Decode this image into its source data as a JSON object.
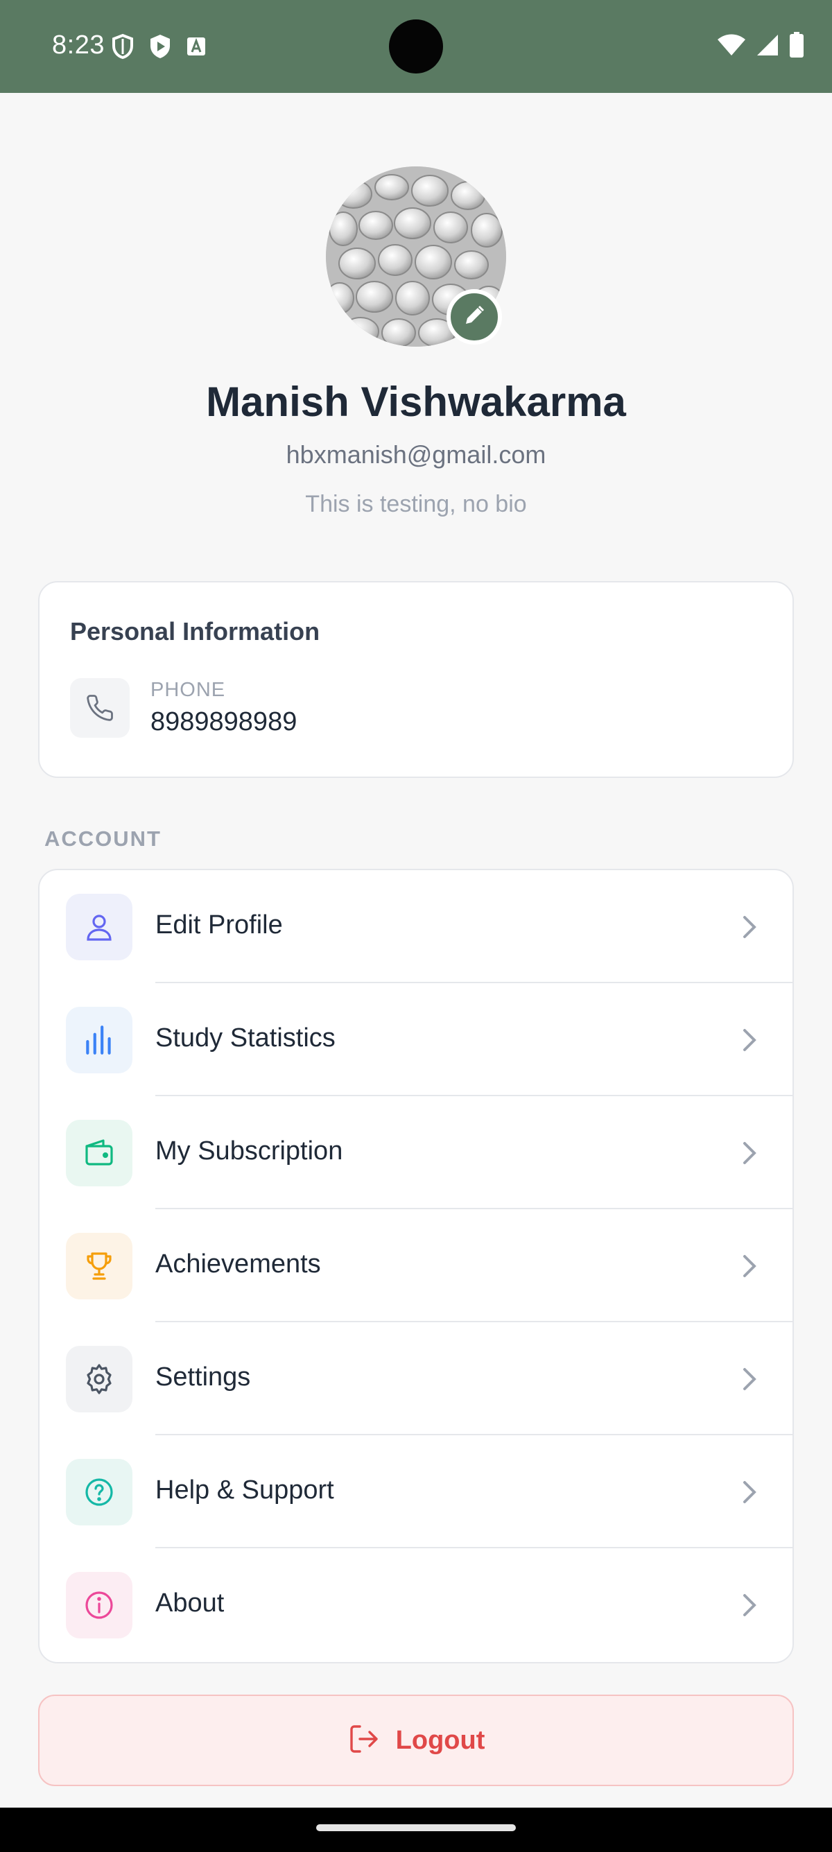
{
  "status_bar": {
    "time": "8:23",
    "icons_left": [
      "shield-outline-icon",
      "play-shield-icon",
      "font-a-icon"
    ],
    "icons_right": [
      "wifi-icon",
      "signal-icon",
      "battery-icon"
    ],
    "background": "#5a7a62"
  },
  "profile": {
    "name": "Manish Vishwakarma",
    "email": "hbxmanish@gmail.com",
    "bio": "This is testing, no bio",
    "edit_icon": "pencil-icon"
  },
  "personal_info": {
    "title": "Personal Information",
    "phone_label": "PHONE",
    "phone_value": "8989898989",
    "icon": "phone-icon"
  },
  "account": {
    "section_label": "ACCOUNT",
    "items": [
      {
        "label": "Edit Profile",
        "icon": "user-icon",
        "color": "#6366f1"
      },
      {
        "label": "Study Statistics",
        "icon": "bar-chart-icon",
        "color": "#3b82f6"
      },
      {
        "label": "My Subscription",
        "icon": "wallet-icon",
        "color": "#10b981"
      },
      {
        "label": "Achievements",
        "icon": "trophy-icon",
        "color": "#f59e0b"
      },
      {
        "label": "Settings",
        "icon": "gear-icon",
        "color": "#4b5563"
      },
      {
        "label": "Help & Support",
        "icon": "help-circle-icon",
        "color": "#14b8a6"
      },
      {
        "label": "About",
        "icon": "info-circle-icon",
        "color": "#ec4899"
      }
    ]
  },
  "logout": {
    "label": "Logout",
    "icon": "logout-icon",
    "color": "#e04848"
  }
}
